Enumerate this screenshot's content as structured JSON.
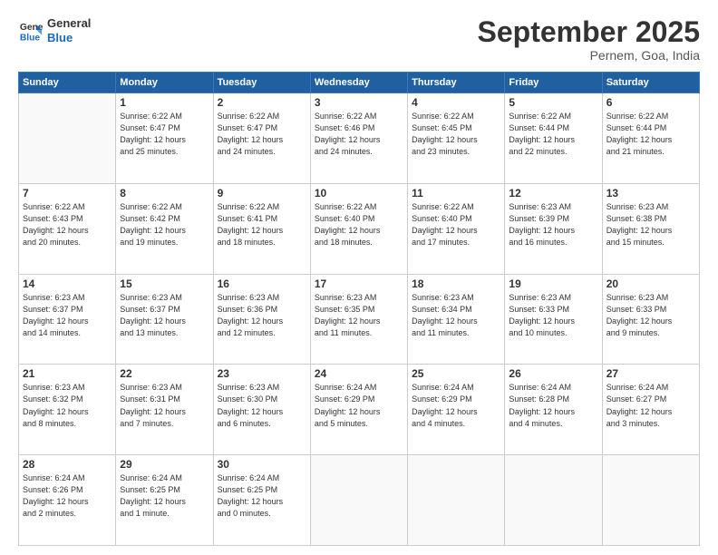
{
  "logo": {
    "text_general": "General",
    "text_blue": "Blue"
  },
  "header": {
    "month": "September 2025",
    "location": "Pernem, Goa, India"
  },
  "weekdays": [
    "Sunday",
    "Monday",
    "Tuesday",
    "Wednesday",
    "Thursday",
    "Friday",
    "Saturday"
  ],
  "weeks": [
    [
      {
        "day": "",
        "lines": []
      },
      {
        "day": "1",
        "lines": [
          "Sunrise: 6:22 AM",
          "Sunset: 6:47 PM",
          "Daylight: 12 hours",
          "and 25 minutes."
        ]
      },
      {
        "day": "2",
        "lines": [
          "Sunrise: 6:22 AM",
          "Sunset: 6:47 PM",
          "Daylight: 12 hours",
          "and 24 minutes."
        ]
      },
      {
        "day": "3",
        "lines": [
          "Sunrise: 6:22 AM",
          "Sunset: 6:46 PM",
          "Daylight: 12 hours",
          "and 24 minutes."
        ]
      },
      {
        "day": "4",
        "lines": [
          "Sunrise: 6:22 AM",
          "Sunset: 6:45 PM",
          "Daylight: 12 hours",
          "and 23 minutes."
        ]
      },
      {
        "day": "5",
        "lines": [
          "Sunrise: 6:22 AM",
          "Sunset: 6:44 PM",
          "Daylight: 12 hours",
          "and 22 minutes."
        ]
      },
      {
        "day": "6",
        "lines": [
          "Sunrise: 6:22 AM",
          "Sunset: 6:44 PM",
          "Daylight: 12 hours",
          "and 21 minutes."
        ]
      }
    ],
    [
      {
        "day": "7",
        "lines": [
          "Sunrise: 6:22 AM",
          "Sunset: 6:43 PM",
          "Daylight: 12 hours",
          "and 20 minutes."
        ]
      },
      {
        "day": "8",
        "lines": [
          "Sunrise: 6:22 AM",
          "Sunset: 6:42 PM",
          "Daylight: 12 hours",
          "and 19 minutes."
        ]
      },
      {
        "day": "9",
        "lines": [
          "Sunrise: 6:22 AM",
          "Sunset: 6:41 PM",
          "Daylight: 12 hours",
          "and 18 minutes."
        ]
      },
      {
        "day": "10",
        "lines": [
          "Sunrise: 6:22 AM",
          "Sunset: 6:40 PM",
          "Daylight: 12 hours",
          "and 18 minutes."
        ]
      },
      {
        "day": "11",
        "lines": [
          "Sunrise: 6:22 AM",
          "Sunset: 6:40 PM",
          "Daylight: 12 hours",
          "and 17 minutes."
        ]
      },
      {
        "day": "12",
        "lines": [
          "Sunrise: 6:23 AM",
          "Sunset: 6:39 PM",
          "Daylight: 12 hours",
          "and 16 minutes."
        ]
      },
      {
        "day": "13",
        "lines": [
          "Sunrise: 6:23 AM",
          "Sunset: 6:38 PM",
          "Daylight: 12 hours",
          "and 15 minutes."
        ]
      }
    ],
    [
      {
        "day": "14",
        "lines": [
          "Sunrise: 6:23 AM",
          "Sunset: 6:37 PM",
          "Daylight: 12 hours",
          "and 14 minutes."
        ]
      },
      {
        "day": "15",
        "lines": [
          "Sunrise: 6:23 AM",
          "Sunset: 6:37 PM",
          "Daylight: 12 hours",
          "and 13 minutes."
        ]
      },
      {
        "day": "16",
        "lines": [
          "Sunrise: 6:23 AM",
          "Sunset: 6:36 PM",
          "Daylight: 12 hours",
          "and 12 minutes."
        ]
      },
      {
        "day": "17",
        "lines": [
          "Sunrise: 6:23 AM",
          "Sunset: 6:35 PM",
          "Daylight: 12 hours",
          "and 11 minutes."
        ]
      },
      {
        "day": "18",
        "lines": [
          "Sunrise: 6:23 AM",
          "Sunset: 6:34 PM",
          "Daylight: 12 hours",
          "and 11 minutes."
        ]
      },
      {
        "day": "19",
        "lines": [
          "Sunrise: 6:23 AM",
          "Sunset: 6:33 PM",
          "Daylight: 12 hours",
          "and 10 minutes."
        ]
      },
      {
        "day": "20",
        "lines": [
          "Sunrise: 6:23 AM",
          "Sunset: 6:33 PM",
          "Daylight: 12 hours",
          "and 9 minutes."
        ]
      }
    ],
    [
      {
        "day": "21",
        "lines": [
          "Sunrise: 6:23 AM",
          "Sunset: 6:32 PM",
          "Daylight: 12 hours",
          "and 8 minutes."
        ]
      },
      {
        "day": "22",
        "lines": [
          "Sunrise: 6:23 AM",
          "Sunset: 6:31 PM",
          "Daylight: 12 hours",
          "and 7 minutes."
        ]
      },
      {
        "day": "23",
        "lines": [
          "Sunrise: 6:23 AM",
          "Sunset: 6:30 PM",
          "Daylight: 12 hours",
          "and 6 minutes."
        ]
      },
      {
        "day": "24",
        "lines": [
          "Sunrise: 6:24 AM",
          "Sunset: 6:29 PM",
          "Daylight: 12 hours",
          "and 5 minutes."
        ]
      },
      {
        "day": "25",
        "lines": [
          "Sunrise: 6:24 AM",
          "Sunset: 6:29 PM",
          "Daylight: 12 hours",
          "and 4 minutes."
        ]
      },
      {
        "day": "26",
        "lines": [
          "Sunrise: 6:24 AM",
          "Sunset: 6:28 PM",
          "Daylight: 12 hours",
          "and 4 minutes."
        ]
      },
      {
        "day": "27",
        "lines": [
          "Sunrise: 6:24 AM",
          "Sunset: 6:27 PM",
          "Daylight: 12 hours",
          "and 3 minutes."
        ]
      }
    ],
    [
      {
        "day": "28",
        "lines": [
          "Sunrise: 6:24 AM",
          "Sunset: 6:26 PM",
          "Daylight: 12 hours",
          "and 2 minutes."
        ]
      },
      {
        "day": "29",
        "lines": [
          "Sunrise: 6:24 AM",
          "Sunset: 6:25 PM",
          "Daylight: 12 hours",
          "and 1 minute."
        ]
      },
      {
        "day": "30",
        "lines": [
          "Sunrise: 6:24 AM",
          "Sunset: 6:25 PM",
          "Daylight: 12 hours",
          "and 0 minutes."
        ]
      },
      {
        "day": "",
        "lines": []
      },
      {
        "day": "",
        "lines": []
      },
      {
        "day": "",
        "lines": []
      },
      {
        "day": "",
        "lines": []
      }
    ]
  ]
}
